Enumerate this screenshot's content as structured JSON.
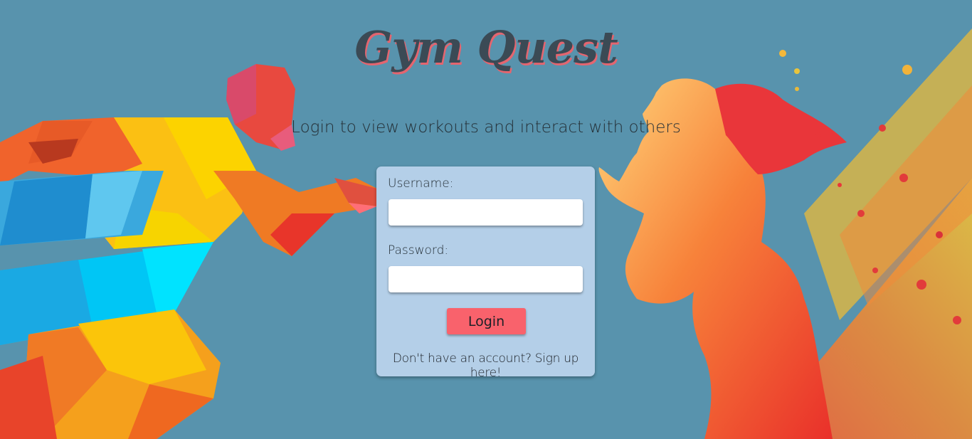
{
  "header": {
    "title": "Gym Quest",
    "subtitle": "Login to view workouts and interact with others"
  },
  "login_form": {
    "username_label": "Username:",
    "username_value": "",
    "password_label": "Password:",
    "password_value": "",
    "login_button_label": "Login",
    "signup_link_text": "Don't have an account? Sign up here!"
  },
  "colors": {
    "background": "#5893ad",
    "card": "#b4cfe8",
    "accent": "#f9626c",
    "title_text": "#3b4a55"
  },
  "decorations": {
    "left_image": "low-poly-sprinter-illustration",
    "right_image": "watercolor-woman-runner-illustration"
  }
}
